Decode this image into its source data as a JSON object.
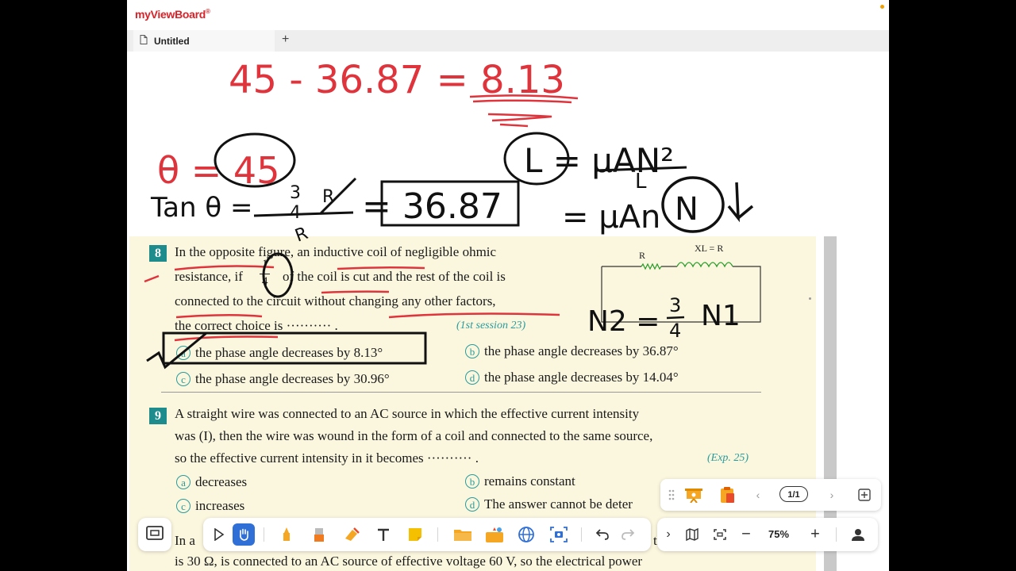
{
  "app": {
    "name": "myViewBoard",
    "brand_color": "#d8232a"
  },
  "tab": {
    "label": "Untitled",
    "add": "+"
  },
  "handwriting": {
    "top_equation": "45 - 36.87 = 8.13",
    "theta": "θ = 45",
    "tan": "Tan θ = ",
    "tan_num": "3",
    "tan_den": "4",
    "tan_R": "R",
    "boxed_result": "= 36.87",
    "inductance": "L = μAN²",
    "inductance_den": "L",
    "mu_an": "= μAn",
    "N": "N",
    "n2": "N2 = ",
    "n2_num": "3",
    "n2_den": "4",
    "n1": "N1"
  },
  "q8": {
    "num": "8",
    "line1": "In the opposite figure, an inductive coil of negligible ohmic",
    "line2a": "resistance, if",
    "frac_num": "1",
    "frac_den": "4",
    "line2b": "of the coil is cut and the rest of the coil is",
    "line3": "connected to the circuit without changing any other factors,",
    "line4": "the correct choice is ·········· .",
    "source": "(1st session 23)",
    "options": [
      {
        "letter": "a",
        "text": "the phase angle decreases by 8.13°"
      },
      {
        "letter": "b",
        "text": "the phase angle decreases by 36.87°"
      },
      {
        "letter": "c",
        "text": "the phase angle decreases by 30.96°"
      },
      {
        "letter": "d",
        "text": "the phase angle decreases by 14.04°"
      }
    ],
    "circuit": {
      "r_label": "R",
      "xl_label": "XL = R"
    }
  },
  "q9": {
    "num": "9",
    "line1": "A straight wire was connected to an AC source in which the effective current intensity",
    "line2": "was (I), then the wire was wound in the form of a coil and connected to the same source,",
    "line3": "so the effective current intensity in it becomes ·········· .",
    "source": "(Exp. 25)",
    "options": [
      {
        "letter": "a",
        "text": "decreases"
      },
      {
        "letter": "b",
        "text": "remains constant"
      },
      {
        "letter": "c",
        "text": "increases"
      },
      {
        "letter": "d",
        "text": "The answer cannot be deter"
      }
    ]
  },
  "q10": {
    "line1_start": "In a",
    "line1_end": "thr",
    "line2": "is 30 Ω, is connected to an AC source of effective voltage 60 V, so the electrical power"
  },
  "pagebar": {
    "page": "1/1"
  },
  "zoombar": {
    "zoom": "75%"
  }
}
